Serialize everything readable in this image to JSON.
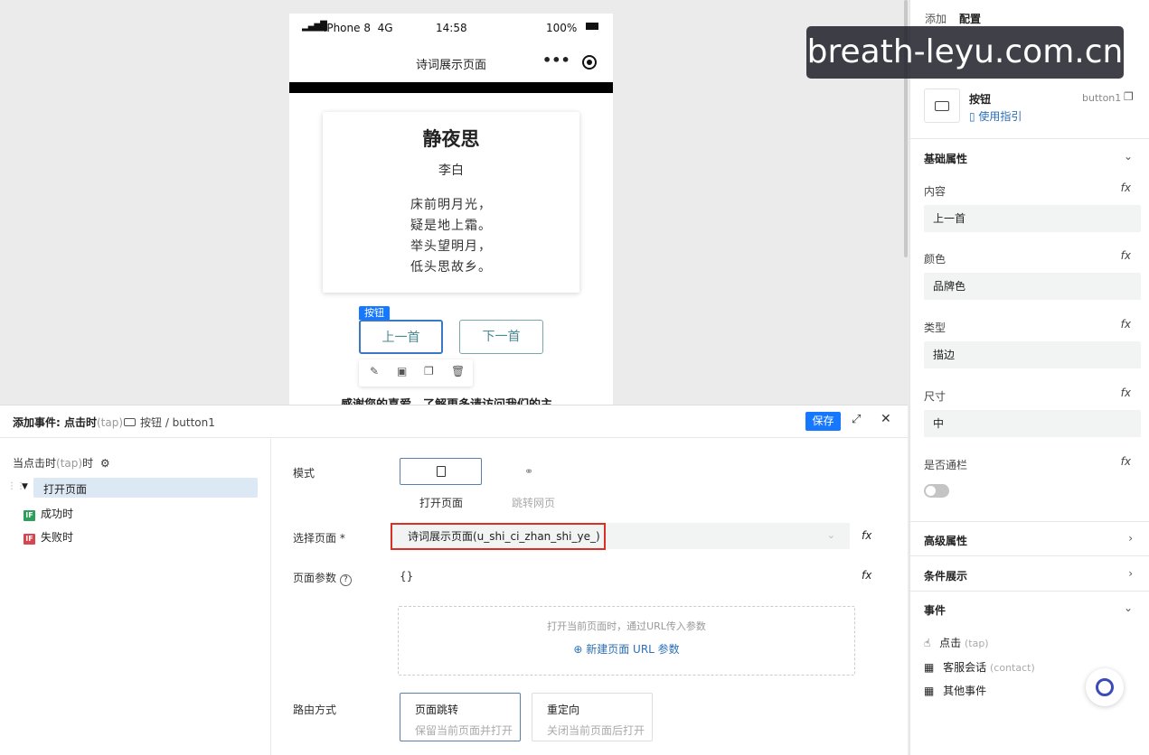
{
  "canvas": {
    "phone": {
      "carrier": "iPhone 8  4G",
      "time": "14:58",
      "battery": "100%",
      "nav_title": "诗词展示页面",
      "poem": {
        "title": "静夜思",
        "author": "李白",
        "lines": [
          "床前明月光，",
          "疑是地上霜。",
          "举头望明月，",
          "低头思故乡。"
        ]
      },
      "button_tag": "按钮",
      "prev_button": "上一首",
      "next_button": "下一首",
      "cutoff_text": "感谢您的喜爱，了解更多请访问我们的主"
    }
  },
  "right_panel": {
    "tabs": [
      "添加",
      "配置"
    ],
    "component_name": "按钮",
    "component_id": "button1",
    "guide_link": "使用指引",
    "basic_section": "基础属性",
    "fields": [
      {
        "label": "内容",
        "value": "上一首"
      },
      {
        "label": "颜色",
        "value": "品牌色"
      },
      {
        "label": "类型",
        "value": "描边"
      },
      {
        "label": "尺寸",
        "value": "中"
      }
    ],
    "fullwidth_label": "是否通栏",
    "advanced_section": "高级属性",
    "condition_section": "条件展示",
    "events_section": "事件",
    "events": [
      {
        "label": "点击",
        "sub": "(tap)"
      },
      {
        "label": "客服会话",
        "sub": "(contact)"
      },
      {
        "label": "其他事件",
        "sub": ""
      }
    ],
    "fx": "fx"
  },
  "editor": {
    "title": "添加事件: 点击时",
    "title_sub": "(tap)",
    "breadcrumb": "按钮 / button1",
    "save": "保存",
    "tree": {
      "trigger": "当点击时",
      "trigger_sub": "(tap)",
      "trigger_suffix": "时",
      "action": "打开页面",
      "success": "成功时",
      "fail": "失败时",
      "if_badge": "IF"
    },
    "mode_label": "模式",
    "mode_open_page": "打开页面",
    "mode_jump_web": "跳转网页",
    "select_page_label": "选择页面 *",
    "select_page_value": "诗词展示页面(u_shi_ci_zhan_shi_ye_)",
    "page_params_label": "页面参数",
    "page_params_value": "{}",
    "params_hint": "打开当前页面时，通过URL传入参数",
    "new_param": "新建页面 URL 参数",
    "route_label": "路由方式",
    "route_options": [
      {
        "title": "页面跳转",
        "desc": "保留当前页面并打开"
      },
      {
        "title": "重定向",
        "desc": "关闭当前页面后打开"
      }
    ]
  },
  "watermark": "breath-leyu.com.cn",
  "colors": {
    "brand": "#1677ff",
    "highlight": "#d93025",
    "outline": "#7aa7ad"
  }
}
